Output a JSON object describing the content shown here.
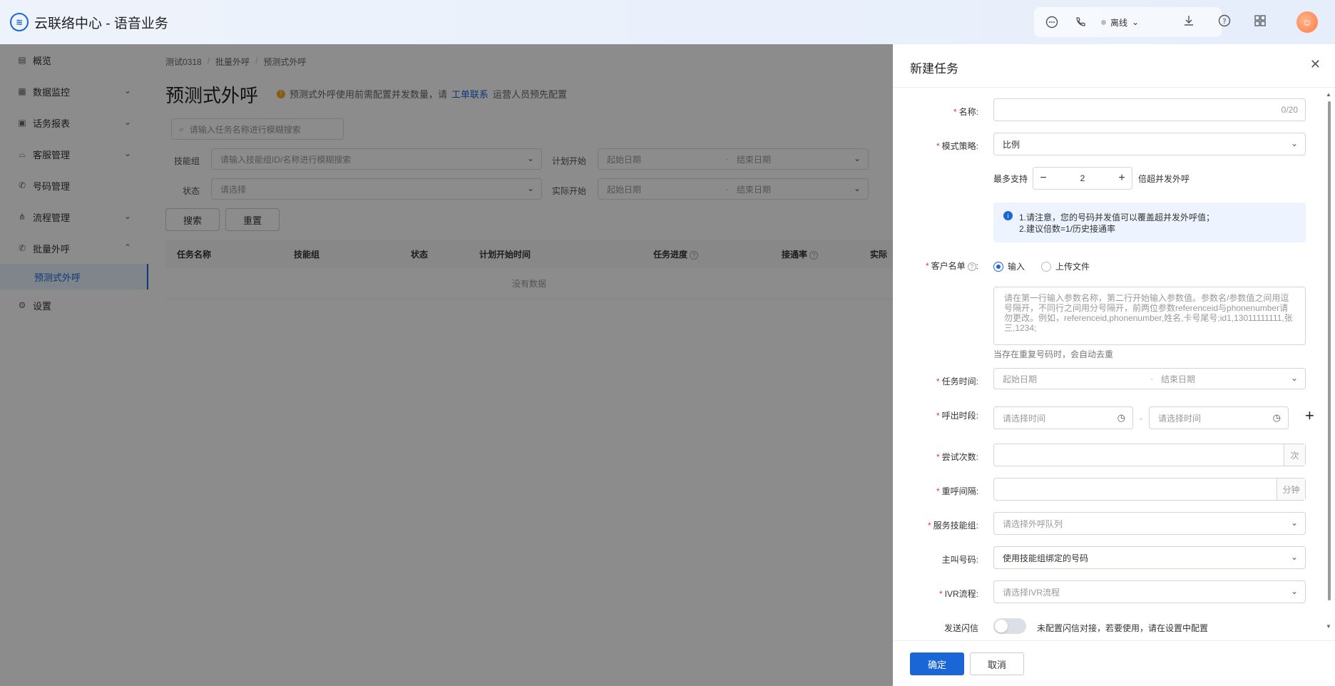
{
  "header": {
    "app_title": "云联络中心 - 语音业务",
    "status_label": "离线"
  },
  "sidebar": {
    "items": [
      {
        "label": "概览",
        "icon": "overview-icon",
        "chevron": false
      },
      {
        "label": "数据监控",
        "icon": "monitor-icon",
        "chevron": "down"
      },
      {
        "label": "话务报表",
        "icon": "report-icon",
        "chevron": "down"
      },
      {
        "label": "客服管理",
        "icon": "headset-icon",
        "chevron": "down"
      },
      {
        "label": "号码管理",
        "icon": "phone-icon",
        "chevron": false
      },
      {
        "label": "流程管理",
        "icon": "flow-icon",
        "chevron": "down"
      },
      {
        "label": "批量外呼",
        "icon": "phone-icon",
        "chevron": "up"
      }
    ],
    "sub_item": "预测式外呼",
    "settings": "设置"
  },
  "main": {
    "breadcrumb": [
      "测试0318",
      "批量外呼",
      "预测式外呼"
    ],
    "title": "预测式外呼",
    "note_prefix": "预测式外呼使用前需配置并发数量，请",
    "note_link": "工单联系",
    "note_suffix": "运营人员预先配置",
    "search_placeholder": "请输入任务名称进行模糊搜索",
    "filters": {
      "skill_label": "技能组",
      "skill_placeholder": "请输入技能组ID/名称进行模糊搜索",
      "plan_label": "计划开始",
      "status_label": "状态",
      "status_placeholder": "请选择",
      "actual_label": "实际开始",
      "start_placeholder": "起始日期",
      "end_placeholder": "结束日期"
    },
    "search_btn": "搜索",
    "reset_btn": "重置",
    "columns": [
      "任务名称",
      "技能组",
      "状态",
      "计划开始时间",
      "任务进度",
      "接通率",
      "实际"
    ],
    "empty_text": "没有数据"
  },
  "drawer": {
    "title": "新建任务",
    "name_label": "名称:",
    "name_counter": "0/20",
    "mode_label": "模式策略:",
    "mode_value": "比例",
    "max_prefix": "最多支持",
    "max_value": "2",
    "max_suffix": "倍超并发外呼",
    "info_line1": "1.请注意，您的号码并发值可以覆盖超并发外呼值；",
    "info_line2": "2.建议倍数=1/历史接通率",
    "customer_label": "客户名单",
    "radio_input": "输入",
    "radio_upload": "上传文件",
    "textarea_placeholder": "请在第一行输入参数名称，第二行开始输入参数值。参数名/参数值之间用逗号隔开，不同行之间用分号隔开，前两位参数referenceid与phonenumber请勿更改。例如，referenceid,phonenumber,姓名,卡号尾号;id1,13011111111,张三,1234;",
    "dedupe_hint": "当存在重复号码时，会自动去重",
    "task_time_label": "任务时间:",
    "start_placeholder": "起始日期",
    "end_placeholder": "结束日期",
    "call_period_label": "呼出时段:",
    "time_placeholder": "请选择时间",
    "attempts_label": "尝试次数:",
    "attempts_suffix": "次",
    "interval_label": "重呼间隔:",
    "interval_suffix": "分钟",
    "skill_group_label": "服务技能组:",
    "skill_group_placeholder": "请选择外呼队列",
    "caller_label": "主叫号码:",
    "caller_value": "使用技能组绑定的号码",
    "ivr_label": "IVR流程:",
    "ivr_placeholder": "请选择IVR流程",
    "flash_label": "发送闪信",
    "flash_hint": "未配置闪信对接，若要使用，请在设置中配置",
    "confirm_btn": "确定",
    "cancel_btn": "取消"
  },
  "colors": {
    "primary": "#1b66d6",
    "required": "#e53935",
    "warning": "#f5a623"
  }
}
